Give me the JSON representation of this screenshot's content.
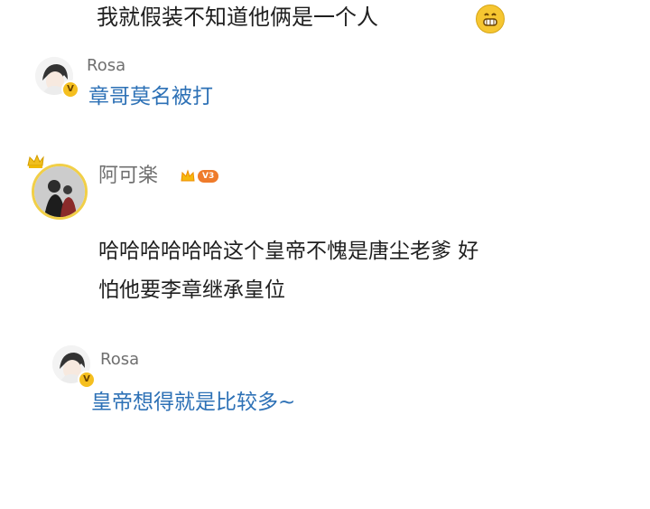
{
  "top_comment": {
    "text": "我就假装不知道他俩是一个人",
    "emoji": "grinning-face"
  },
  "reply1": {
    "username": "Rosa",
    "verified_badge": "V",
    "text": "章哥莫名被打"
  },
  "comment2": {
    "username": "阿可楽",
    "vip_badge": "V3",
    "line1": "哈哈哈哈哈哈这个皇帝不愧是唐尘老爹 好",
    "line2": "怕他要李章继承皇位"
  },
  "reply2": {
    "username": "Rosa",
    "verified_badge": "V",
    "text": "皇帝想得就是比较多~"
  }
}
